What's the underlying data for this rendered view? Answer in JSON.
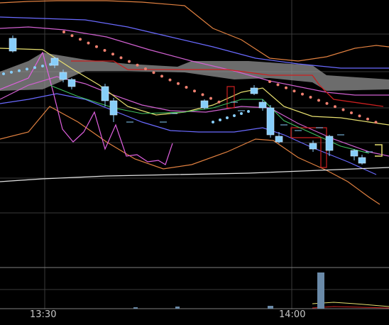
{
  "chart_data": {
    "type": "candlestick",
    "title": "",
    "xlabel": "",
    "ylabel": "",
    "x_tick_labels": [
      "13:30",
      "14:00"
    ],
    "grid": true,
    "legend": "none",
    "colors": {
      "background": "#000000",
      "grid": "#3a3a3a",
      "candle": "#87cefa",
      "cloud": "#8c8c8c",
      "sar_upper": "#f08070",
      "sar_lower": "#87cefa",
      "bollinger_outer": "#e08040",
      "bollinger_inner": "#6a6aff",
      "envelope": "#d060d0",
      "conversion_line": "#e8e070",
      "base_line": "#cc2020",
      "lagging_line": "#e060e0",
      "long_ma": "#e0e0e0",
      "volume": "#6a8aa8"
    },
    "candles": [
      {
        "t": 1,
        "o": 9,
        "h": 11,
        "l": 8,
        "c": 10
      },
      {
        "t": 2,
        "o": 8,
        "h": 10,
        "l": 7,
        "c": 9
      },
      {
        "t": 3,
        "o": 7,
        "h": 9,
        "l": 6,
        "c": 8
      },
      {
        "t": 4,
        "o": 6,
        "h": 8,
        "l": 5,
        "c": 7
      }
    ],
    "volume": [
      0,
      0,
      0,
      0,
      7,
      1
    ]
  }
}
